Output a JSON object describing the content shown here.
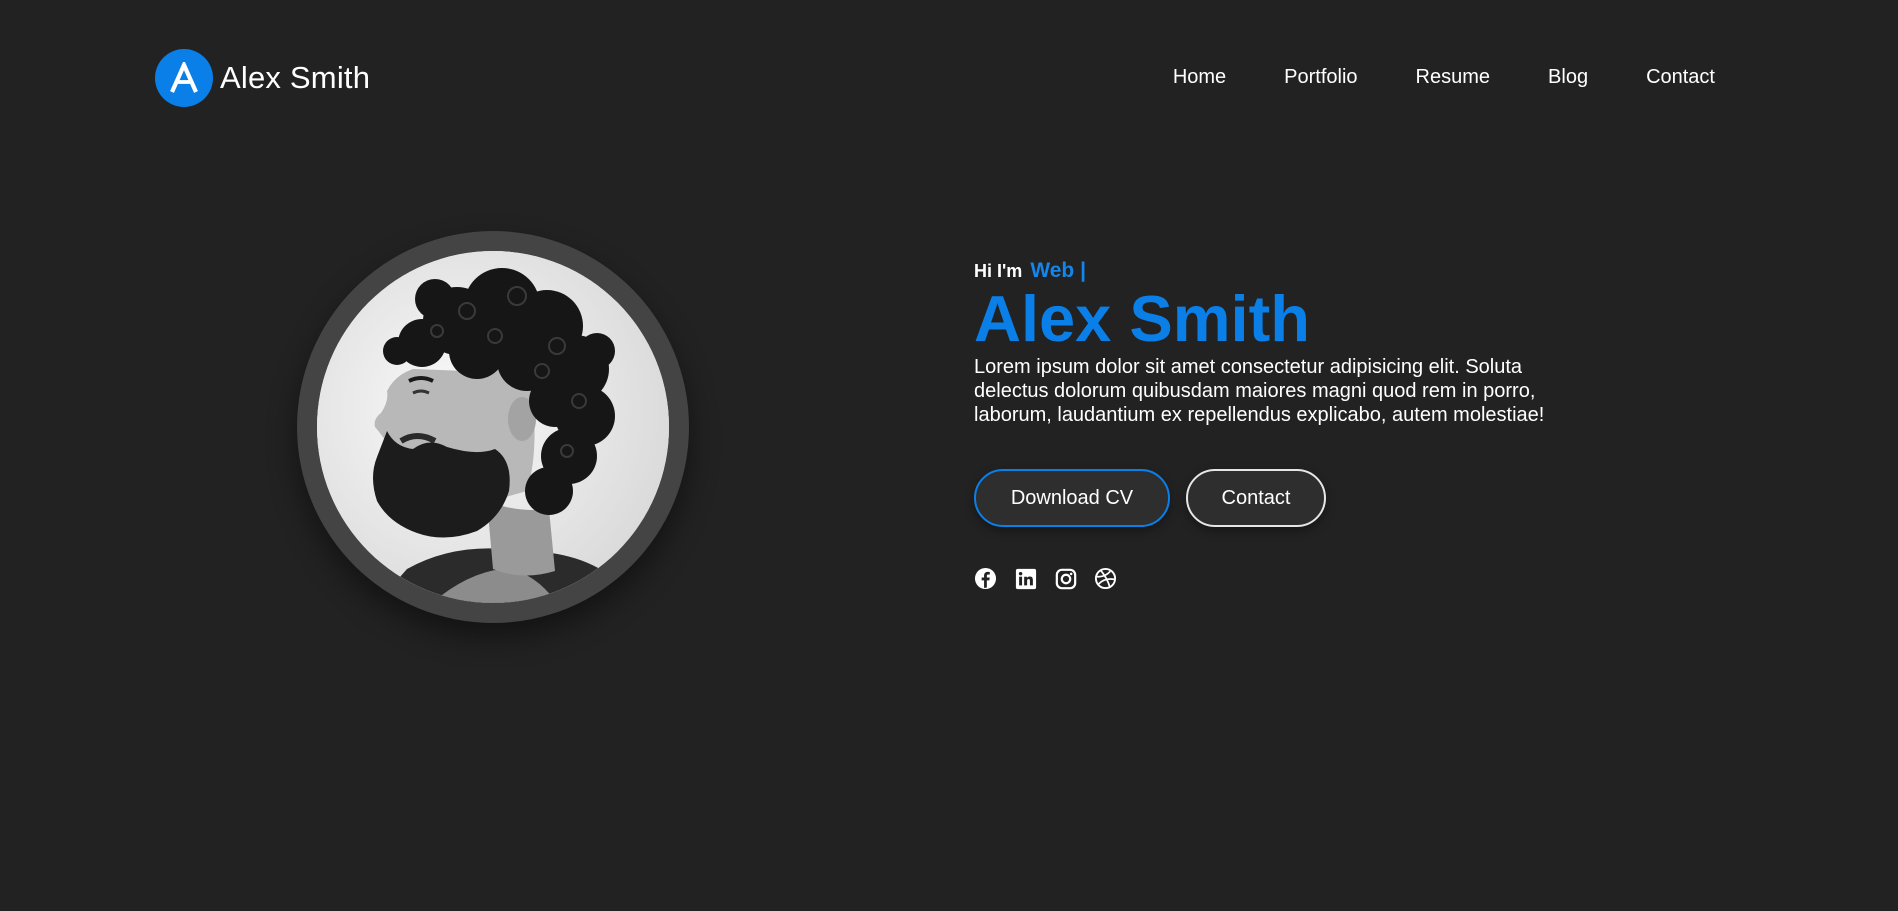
{
  "brand": {
    "initial": "A",
    "name": "Alex Smith"
  },
  "nav": {
    "items": [
      {
        "label": "Home"
      },
      {
        "label": "Portfolio"
      },
      {
        "label": "Resume"
      },
      {
        "label": "Blog"
      },
      {
        "label": "Contact"
      }
    ]
  },
  "hero": {
    "greeting": "Hi I'm",
    "role": "Web |",
    "name": "Alex Smith",
    "intro": "Lorem ipsum dolor sit amet consectetur adipisicing elit. Soluta delectus dolorum quibusdam maiores magni quod rem in porro, laborum, laudantium ex repellendus explicabo, autem molestiae!",
    "download_label": "Download CV",
    "contact_label": "Contact",
    "portrait_icon": "bearded-man-portrait"
  },
  "socials": [
    {
      "icon": "facebook-icon"
    },
    {
      "icon": "linkedin-icon"
    },
    {
      "icon": "instagram-icon"
    },
    {
      "icon": "dribbble-icon"
    }
  ],
  "colors": {
    "background": "#222222",
    "accent": "#0a7fe8",
    "text": "#ffffff",
    "ring": "#444444"
  }
}
